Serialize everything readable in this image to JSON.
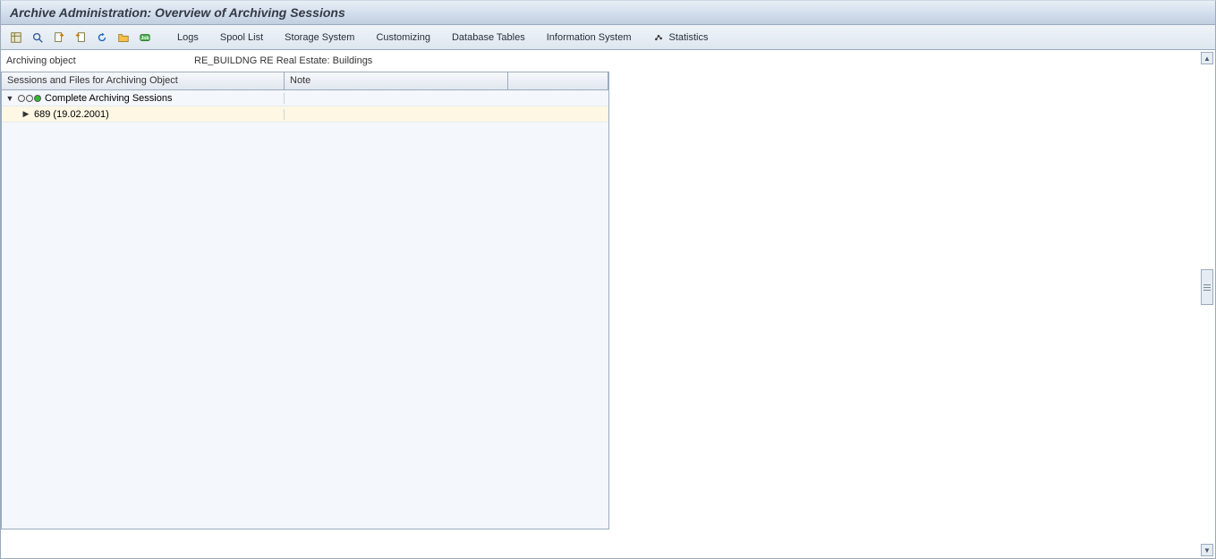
{
  "title": "Archive Administration: Overview of Archiving Sessions",
  "toolbar": {
    "text_items": [
      "Logs",
      "Spool List",
      "Storage System",
      "Customizing",
      "Database Tables",
      "Information System"
    ],
    "stats_label": "Statistics"
  },
  "info": {
    "label": "Archiving object",
    "value": "RE_BUILDNG  RE Real Estate: Buildings"
  },
  "grid": {
    "headers": {
      "col1": "Sessions and Files for Archiving Object",
      "col2": "Note",
      "col3": ""
    },
    "rows": [
      {
        "label": "Complete Archiving Sessions",
        "expanded": true,
        "status": "green",
        "note": ""
      },
      {
        "label": "689 (19.02.2001)",
        "child": true,
        "expanded": false,
        "note": ""
      }
    ]
  }
}
